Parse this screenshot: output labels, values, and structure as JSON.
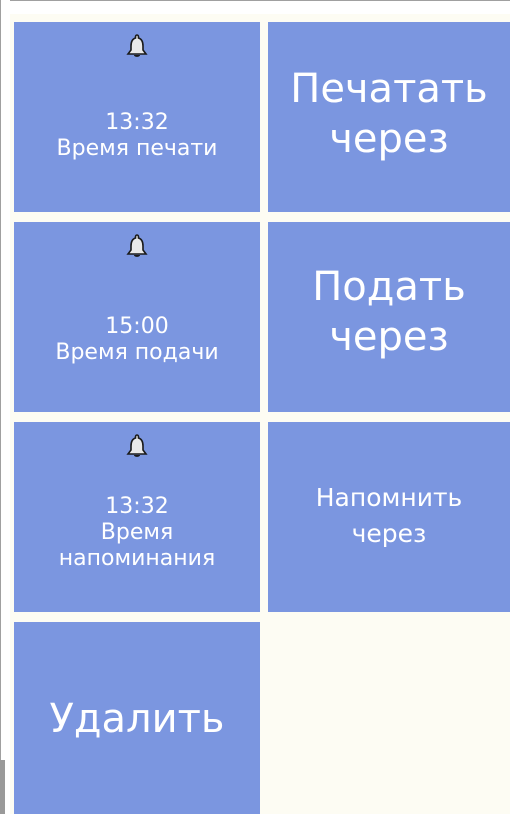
{
  "tiles": {
    "print_time": {
      "time": "13:32",
      "label": "Время печати",
      "icon": "bell-icon"
    },
    "print_after": {
      "label_line1": "Печатать",
      "label_line2": "через"
    },
    "serve_time": {
      "time": "15:00",
      "label": "Время подачи",
      "icon": "bell-icon"
    },
    "serve_after": {
      "label_line1": "Подать",
      "label_line2": "через"
    },
    "remind_time": {
      "time": "13:32",
      "label_line1": "Время",
      "label_line2": "напоминания",
      "icon": "bell-icon"
    },
    "remind_after": {
      "label_line1": "Напомнить",
      "label_line2": "через"
    },
    "delete": {
      "label": "Удалить"
    }
  },
  "colors": {
    "tile": "#7b96e0",
    "text": "#ffffff",
    "background": "#fdfcf3"
  }
}
